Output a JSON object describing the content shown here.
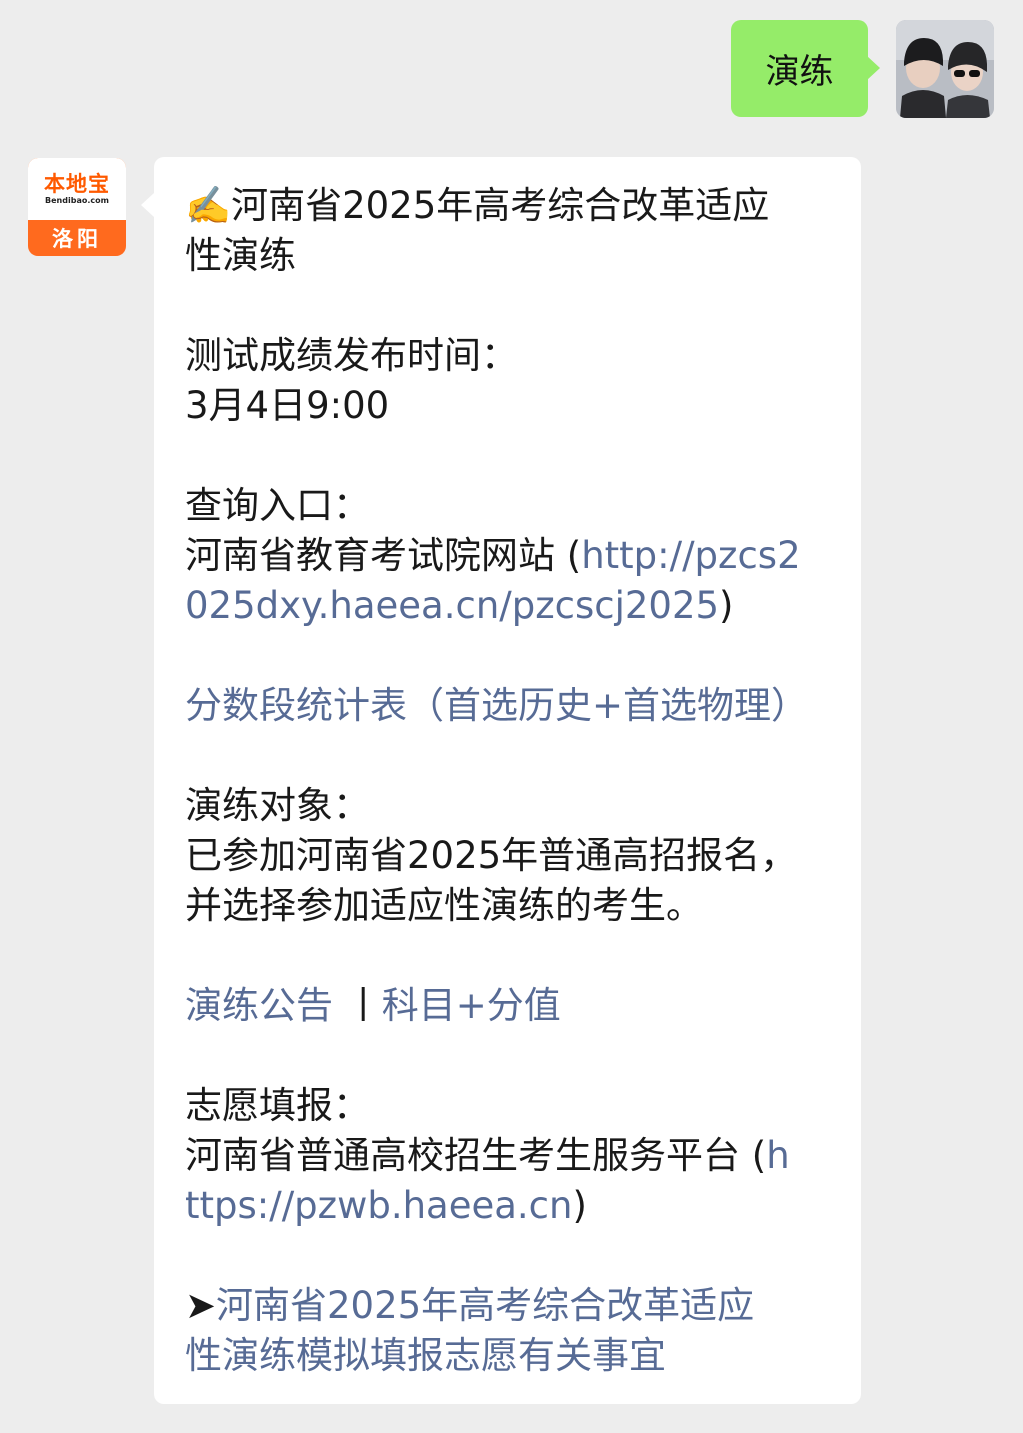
{
  "user_message": {
    "text": "演练"
  },
  "bot": {
    "brand": "本地宝",
    "site": "Bendibao.com",
    "city": "洛阳"
  },
  "reply": {
    "title_emoji": "✍️",
    "title_l1": "河南省2025年高考综合改革适应",
    "title_l2": "性演练",
    "score_label": "测试成绩发布时间：",
    "score_time": "3月4日9:00",
    "query_label": "查询入口：",
    "query_site": "河南省教育考试院网站 (",
    "query_link_l1": "http://pzcs2",
    "query_link_l2": "025dxy.haeea.cn/pzcscj2025",
    "query_close": ")",
    "stats_link": "分数段统计表（首选历史+首选物理）",
    "target_label": "演练对象：",
    "target_l1": "已参加河南省2025年普通高招报名，",
    "target_l2": "并选择参加适应性演练的考生。",
    "notice_link": "演练公告",
    "separator": "丨",
    "subjects_link": "科目+分值",
    "volunteer_label": "志愿填报：",
    "volunteer_site": "河南省普通高校招生考生服务平台 (",
    "volunteer_link_l1": "h",
    "volunteer_link_l2": "ttps://pzwb.haeea.cn",
    "volunteer_close": ")",
    "arrow": "➤",
    "bottom_link_l1": "河南省2025年高考综合改革适应",
    "bottom_link_l2": "性演练模拟填报志愿有关事宜"
  },
  "colors": {
    "background": "#ededed",
    "outgoing_bubble": "#95ec69",
    "incoming_bubble": "#ffffff",
    "link": "#576b95",
    "brand_orange": "#ff6a1e"
  }
}
